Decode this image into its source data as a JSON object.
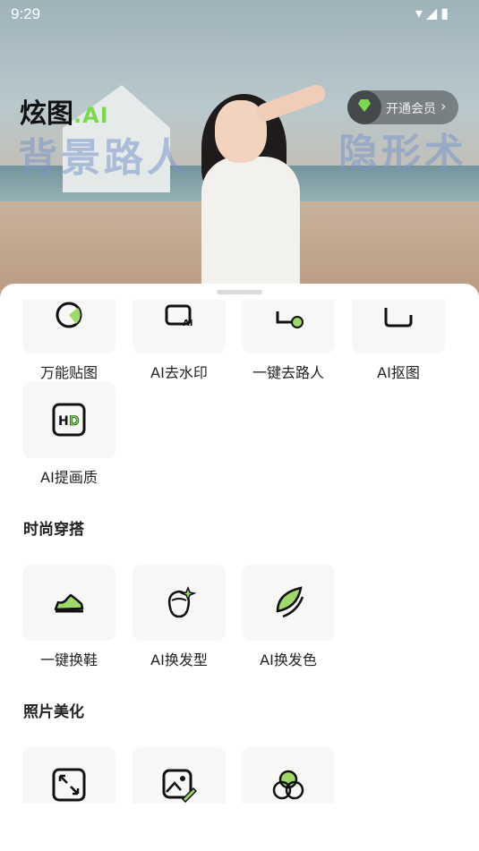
{
  "status_bar": {
    "time": "9:29",
    "icons": "▾◢▮"
  },
  "hero": {
    "logo_main": "炫图",
    "logo_suffix": ".AI",
    "ghost_left": "背景路人",
    "ghost_right": "隐形术"
  },
  "vip": {
    "label": "开通会员",
    "arrow": "›"
  },
  "tools_row1": [
    "万能贴图",
    "AI去水印",
    "一键去路人",
    "AI抠图"
  ],
  "tools_row2": [
    "AI提画质"
  ],
  "section_fashion": {
    "title": "时尚穿搭",
    "items": [
      "一键换鞋",
      "AI换发型",
      "AI换发色"
    ]
  },
  "section_photo": {
    "title": "照片美化"
  },
  "icons": {
    "row1": [
      "sticker-icon",
      "watermark-remove-icon",
      "remove-person-icon",
      "cutout-icon"
    ],
    "row2": [
      "hd-icon"
    ],
    "fashion": [
      "shoe-icon",
      "hairstyle-icon",
      "hair-color-icon"
    ],
    "photo": [
      "expand-icon",
      "photo-edit-icon",
      "color-circles-icon"
    ]
  },
  "colors": {
    "accent": "#7dd84f"
  }
}
